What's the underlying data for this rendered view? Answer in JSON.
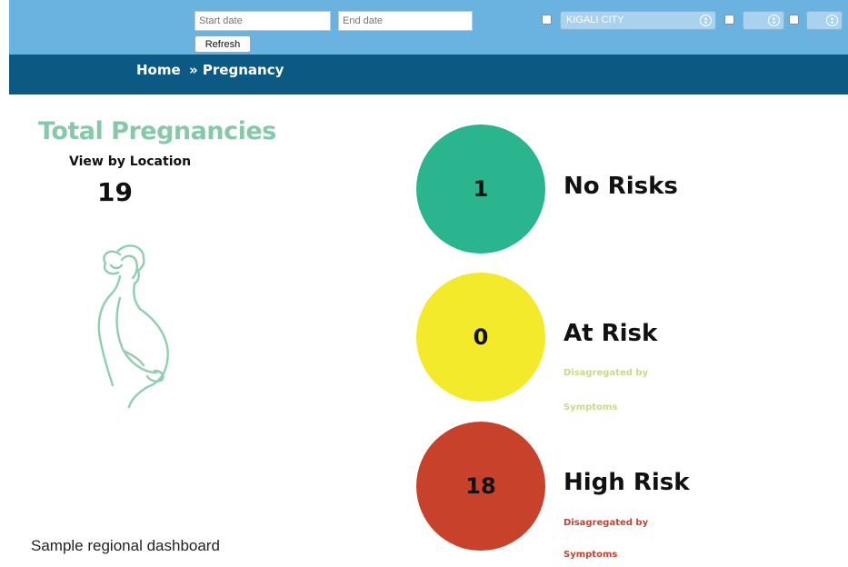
{
  "filters": {
    "start_date_placeholder": "Start date",
    "end_date_placeholder": "End date",
    "refresh_label": "Refresh",
    "region_select": "KIGALI CITY"
  },
  "breadcrumb": {
    "home": "Home",
    "current": "» Pregnancy"
  },
  "summary": {
    "title": "Total Pregnancies",
    "subtitle": "View by Location",
    "total": "19"
  },
  "risks": [
    {
      "count": "1",
      "label": "No Risks",
      "color": "#2ab58f"
    },
    {
      "count": "0",
      "label": "At Risk",
      "color": "#f2ea2a",
      "sub1": "Disagregated by",
      "sub2": "Symptoms",
      "sub_color": "#c9d98a"
    },
    {
      "count": "18",
      "label": "High Risk",
      "color": "#c7412b",
      "sub1": "Disagregated by",
      "sub2": "Symptoms",
      "sub_color": "#c7412b"
    }
  ],
  "caption": "Sample regional dashboard",
  "colors": {
    "topbar": "#6ab3e0",
    "navbar": "#0c5a84",
    "title": "#86c9a9",
    "illustration": "#8fcfb0"
  },
  "icons": {
    "illustration": "pregnant-woman-icon"
  }
}
